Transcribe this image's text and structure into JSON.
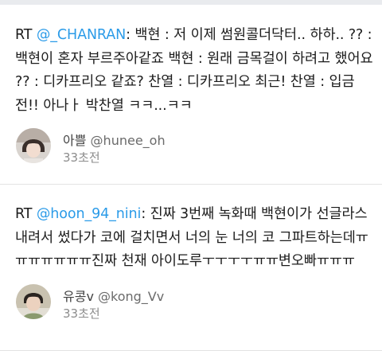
{
  "tweets": [
    {
      "prefix": "RT ",
      "mention": "@_CHANRAN",
      "body": ": 백현 : 저 이제 썸원콜더닥터.. 하하.. ?? : 백현이 혼자 부르주아같죠 백현 : 원래 금목걸이 하려고 했어요 ?? : 디카프리오 같죠? 찬열 : 디카프리오 최근! 찬열 : 입금 전!! 아나ㅏ 박찬열 ㅋㅋ...ㅋㅋ",
      "display_name": "아쁠",
      "handle": "@hunee_oh",
      "time": "33초전",
      "avatar_icon": "user-avatar"
    },
    {
      "prefix": "RT ",
      "mention": "@hoon_94_nini",
      "body": ": 진짜 3번째 녹화때 백현이가 선글라스 내려서 썼다가 코에 걸치면서 너의 눈 너의 코 그파트하는데ㅠㅠㅠㅠㅠㅠㅠ진짜 천재 아이도루ㅜㅜㅜㅜㅠㅠ변오빠ㅠㅠㅠ",
      "display_name": "유콩v",
      "handle": "@kong_Vv",
      "time": "33초전",
      "avatar_icon": "user-avatar"
    }
  ],
  "colors": {
    "mention": "#2b9be8",
    "text": "#1b1b1b",
    "meta": "#8c8c8c"
  }
}
